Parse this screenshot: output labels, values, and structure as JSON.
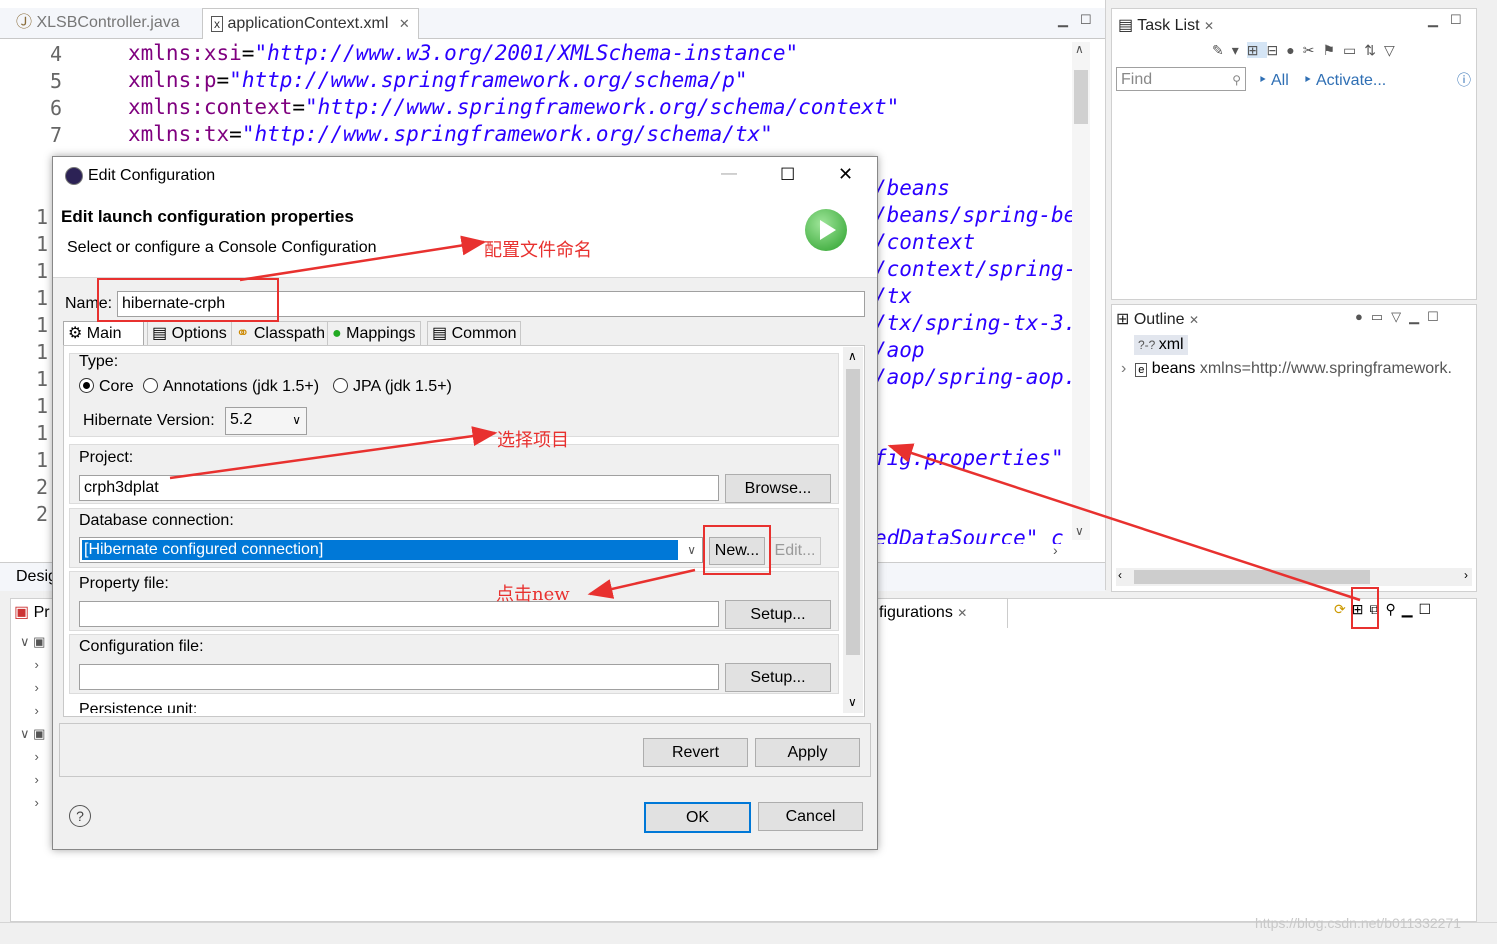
{
  "editor": {
    "tabs": [
      {
        "label": "XLSBController.java",
        "active": false
      },
      {
        "label": "applicationContext.xml",
        "active": true
      }
    ],
    "lines": [
      {
        "num": "4",
        "attr": "xmlns:xsi",
        "val": "\"http://www.w3.org/2001/XMLSchema-instance\""
      },
      {
        "num": "5",
        "attr": "xmlns:p",
        "val": "\"http://www.springframework.org/schema/p\""
      },
      {
        "num": "6",
        "attr": "xmlns:context",
        "val": "\"http://www.springframework.org/schema/context\""
      },
      {
        "num": "7",
        "attr": "xmlns:tx",
        "val": "\"http://www.springframework.org/schema/tx\""
      }
    ],
    "gutter": [
      "1",
      "1",
      "1",
      "1",
      "1",
      "1",
      "1",
      "1",
      "1",
      "1",
      "2",
      "2"
    ],
    "right_fragments": [
      "/beans",
      "/beans/spring-be",
      "/context",
      "/context/spring-",
      "/tx",
      "/tx/spring-tx-3.",
      "/aop",
      "/aop/spring-aop.",
      "fig.properties\"",
      "edDataSource\" c"
    ],
    "design_tab": "Desig"
  },
  "task_list": {
    "title": "Task List",
    "find_placeholder": "Find",
    "all_label": "All",
    "activate_label": "Activate..."
  },
  "outline": {
    "title": "Outline",
    "item1": "xml",
    "item2_name": "beans",
    "item2_attr": "xmlns=http://www.springframework."
  },
  "bottom_panel": {
    "left_tab": "Pr",
    "config_tab": "figurations"
  },
  "dialog": {
    "title": "Edit Configuration",
    "header_title": "Edit launch configuration properties",
    "header_subtitle": "Select or configure a Console Configuration",
    "name_label": "Name:",
    "name_value": "hibernate-crph",
    "tabs": [
      "Main",
      "Options",
      "Classpath",
      "Mappings",
      "Common"
    ],
    "type_label": "Type:",
    "types": [
      "Core",
      "Annotations (jdk 1.5+)",
      "JPA (jdk 1.5+)"
    ],
    "selected_type": "Core",
    "hibernate_version_label": "Hibernate Version:",
    "hibernate_version": "5.2",
    "project_label": "Project:",
    "project_value": "crph3dplat",
    "browse_label": "Browse...",
    "db_label": "Database connection:",
    "db_value": "[Hibernate configured connection]",
    "new_label": "New...",
    "edit_label": "Edit...",
    "property_label": "Property file:",
    "setup_label": "Setup...",
    "config_file_label": "Configuration file:",
    "persistence_label": "Persistence unit:",
    "revert_label": "Revert",
    "apply_label": "Apply",
    "ok_label": "OK",
    "cancel_label": "Cancel"
  },
  "annotations": {
    "name_note": "配置文件命名",
    "project_note": "选择项目",
    "new_note": "点击new"
  },
  "watermark": "https://blog.csdn.net/b011332271"
}
